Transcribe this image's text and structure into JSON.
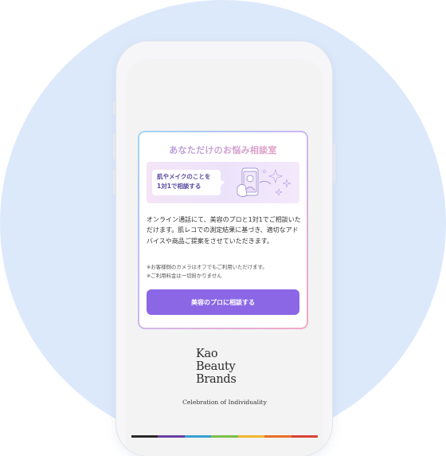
{
  "consult_card": {
    "title": "あなただけのお悩み相談室",
    "banner_lines": [
      "肌やメイクのことを",
      "1対1で相談する"
    ],
    "description": "オンライン通話にて、美容のプロと1対1でご相談いただけます。肌レコでの測定結果に基づき、適切なアドバイスや商品ご提案をさせていただきます。",
    "notes": [
      "※お客様側のカメラはオフでもご利用いただけます。",
      "※ご利用料金は一切掛かりません"
    ],
    "cta_label": "美容のプロに相談する"
  },
  "brand": {
    "logo_lines": [
      "Kao",
      "Beauty",
      "Brands"
    ],
    "tagline": "Celebration of Individuality",
    "color_bar": [
      "#2a2a2a",
      "#6a3fa0",
      "#3aa0d0",
      "#7cbf4a",
      "#f2b731",
      "#e8702a",
      "#d94136"
    ]
  },
  "colors": {
    "accent": "#8b67e6",
    "background_circle": "#dce9fb"
  }
}
